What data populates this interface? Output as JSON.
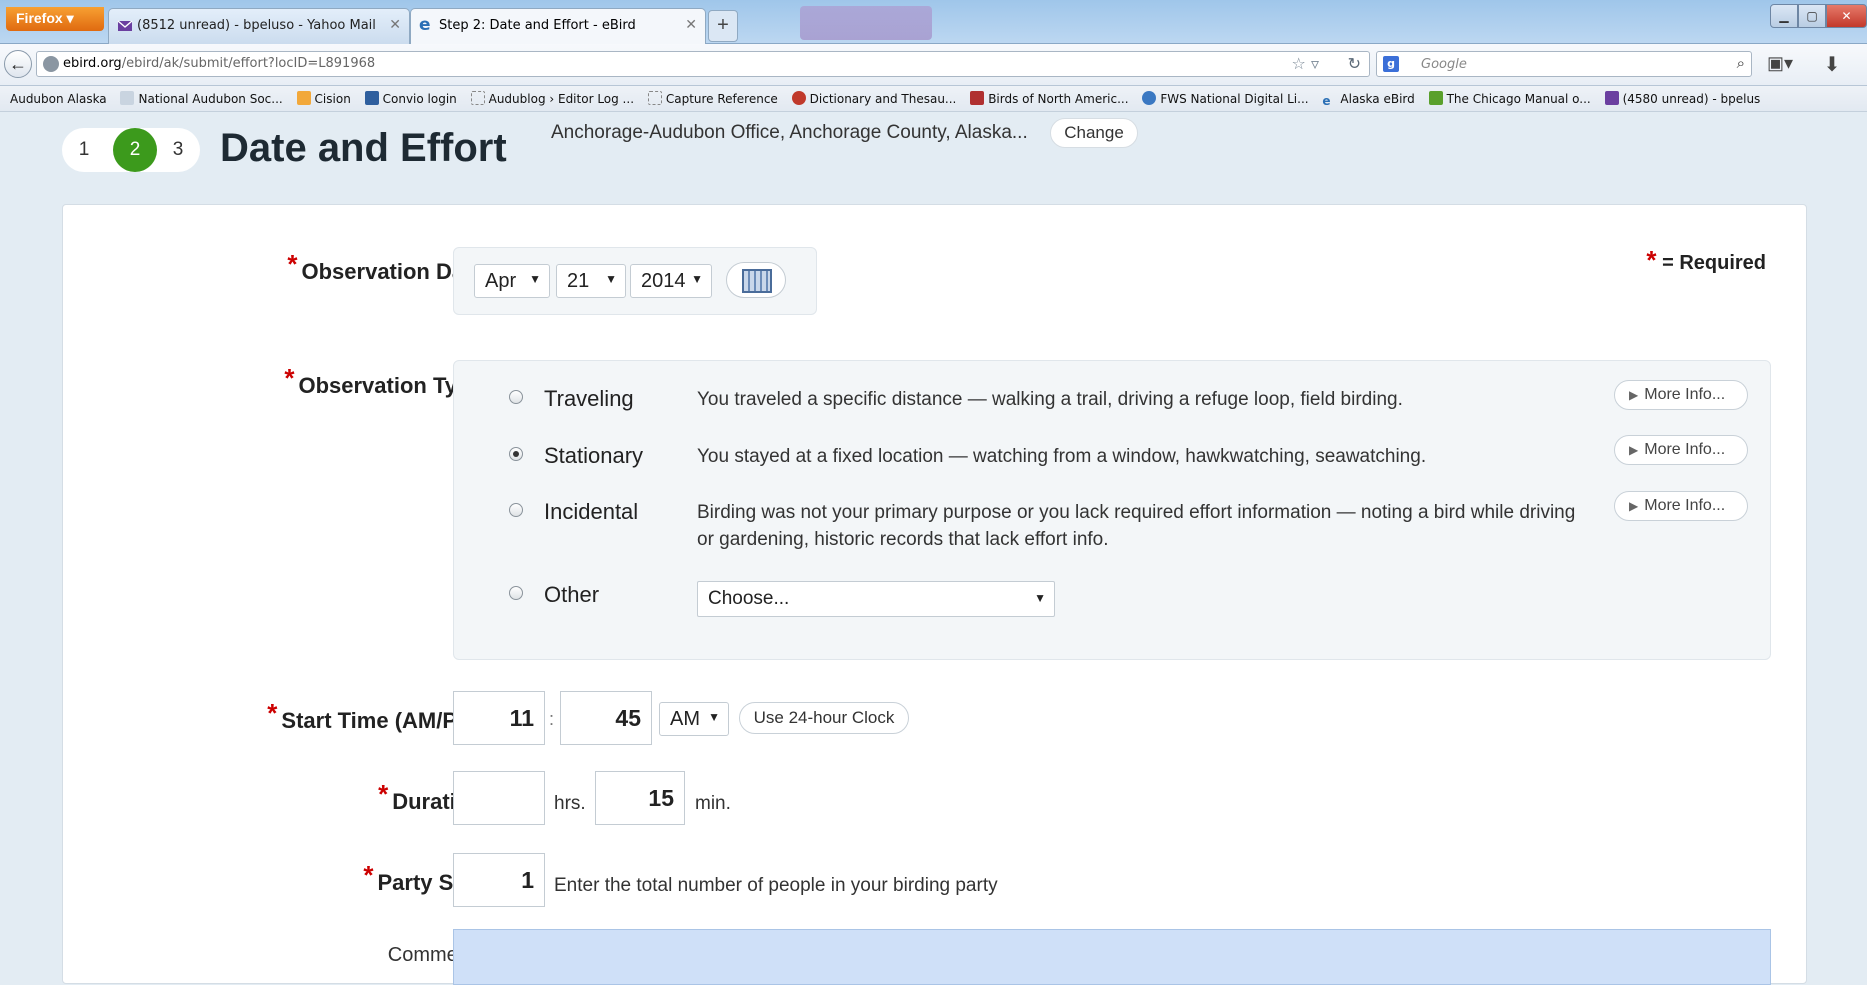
{
  "browser": {
    "app_button": "Firefox",
    "tabs": [
      {
        "label": "(8512 unread) - bpeluso - Yahoo Mail",
        "icon": "mail-icon"
      },
      {
        "label": "Step 2: Date and Effort - eBird",
        "icon": "ebird-icon"
      }
    ],
    "url_domain": "ebird.org",
    "url_path": "/ebird/ak/submit/effort?locID=L891968",
    "search_placeholder": "Google",
    "bookmarks": [
      "Audubon Alaska",
      "National Audubon Soc...",
      "Cision",
      "Convio login",
      "Audublog › Editor Log ...",
      "Capture Reference",
      "Dictionary and Thesau...",
      "Birds of North Americ...",
      "FWS National Digital Li...",
      "Alaska eBird",
      "The Chicago Manual o...",
      "(4580 unread) - bpelus"
    ]
  },
  "page": {
    "steps": [
      "1",
      "2",
      "3"
    ],
    "active_step": "2",
    "title": "Date and Effort",
    "location": "Anchorage-Audubon Office, Anchorage County, Alaska...",
    "change_label": "Change",
    "required_legend": "= Required",
    "date": {
      "label": "Observation Date:",
      "month": "Apr",
      "day": "21",
      "year": "2014"
    },
    "observation_type": {
      "label": "Observation Type:",
      "options": [
        {
          "name": "Traveling",
          "desc": "You traveled a specific distance — walking a trail, driving a refuge loop, field birding.",
          "more": "More Info..."
        },
        {
          "name": "Stationary",
          "desc": "You stayed at a fixed location — watching from a window, hawkwatching, seawatching.",
          "more": "More Info..."
        },
        {
          "name": "Incidental",
          "desc": "Birding was not your primary purpose or you lack required effort information — noting a bird while driving or gardening, historic records that lack effort info.",
          "more": "More Info..."
        },
        {
          "name": "Other",
          "desc": "",
          "more": ""
        }
      ],
      "selected": "Stationary",
      "other_select": "Choose..."
    },
    "start_time": {
      "label": "Start Time (AM/PM):",
      "hour": "11",
      "separator": ":",
      "minute": "45",
      "ampm": "AM",
      "clock24_label": "Use 24-hour Clock"
    },
    "duration": {
      "label": "Duration:",
      "hours": "",
      "hours_unit": "hrs.",
      "minutes": "15",
      "minutes_unit": "min."
    },
    "party_size": {
      "label": "Party Size:",
      "value": "1",
      "hint": "Enter the total number of people in your birding party"
    },
    "comments": {
      "label": "Comments:",
      "value": ""
    }
  }
}
